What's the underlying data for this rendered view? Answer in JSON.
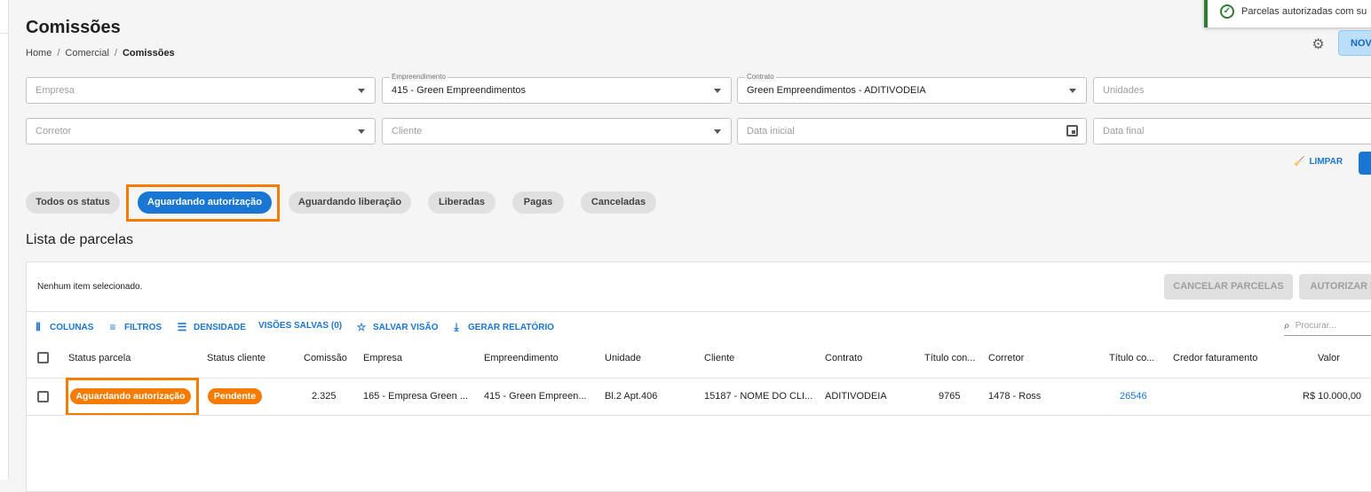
{
  "page": {
    "title": "Comissões",
    "breadcrumb": [
      "Home",
      "Comercial",
      "Comissões"
    ]
  },
  "toast": {
    "message": "Parcelas autorizadas com su"
  },
  "header": {
    "new_button": "NOV"
  },
  "filters": {
    "empresa": {
      "placeholder": "Empresa"
    },
    "empreendimento": {
      "label": "Empreendimento",
      "value": "415 - Green Empreendimentos"
    },
    "contrato": {
      "label": "Contrato",
      "value": "Green Empreendimentos - ADITIVODEIA"
    },
    "unidades": {
      "placeholder": "Unidades"
    },
    "corretor": {
      "placeholder": "Corretor"
    },
    "cliente": {
      "placeholder": "Cliente"
    },
    "data_inicial": {
      "placeholder": "Data inicial"
    },
    "data_final": {
      "placeholder": "Data final"
    },
    "clear_label": "LIMPAR"
  },
  "status_tabs": [
    {
      "label": "Todos os status",
      "active": false
    },
    {
      "label": "Aguardando autorização",
      "active": true
    },
    {
      "label": "Aguardando liberação",
      "active": false
    },
    {
      "label": "Liberadas",
      "active": false
    },
    {
      "label": "Pagas",
      "active": false
    },
    {
      "label": "Canceladas",
      "active": false
    }
  ],
  "list": {
    "title": "Lista de parcelas",
    "selection_text": "Nenhum item selecionado.",
    "actions": {
      "cancel": "CANCELAR PARCELAS",
      "authorize": "AUTORIZAR P"
    },
    "toolbar": {
      "columns": "COLUNAS",
      "filters": "FILTROS",
      "density": "DENSIDADE",
      "saved_views": "VISÕES SALVAS (0)",
      "save_view": "SALVAR VISÃO",
      "report": "GERAR RELATÓRIO",
      "search_placeholder": "Procurar..."
    },
    "columns": [
      "Status parcela",
      "Status cliente",
      "Comissão",
      "Empresa",
      "Empreendimento",
      "Unidade",
      "Cliente",
      "Contrato",
      "Título con...",
      "Corretor",
      "Título co...",
      "Credor faturamento",
      "Valor"
    ],
    "rows": [
      {
        "status_parcela": "Aguardando autorização",
        "status_cliente": "Pendente",
        "comissao": "2.325",
        "empresa": "165 - Empresa Green ...",
        "empreendimento": "415 - Green Empreen...",
        "unidade": "Bl.2 Apt.406",
        "cliente": "15187 - NOME DO CLI...",
        "contrato": "ADITIVODEIA",
        "titulo_con": "9765",
        "corretor": "1478 - Ross",
        "titulo_co": "26546",
        "credor": "",
        "valor": "R$ 10.000,00"
      }
    ]
  },
  "colors": {
    "primary": "#1976d2",
    "highlight": "#f57c00",
    "success": "#2e7d32"
  }
}
